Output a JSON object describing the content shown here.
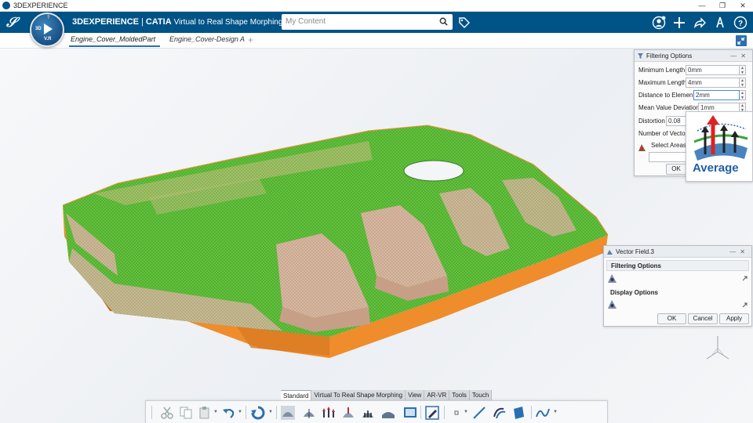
{
  "os": {
    "title": "3DEXPERIENCE",
    "controls": [
      "—",
      "❐",
      "✕"
    ]
  },
  "header": {
    "brand_bold": "3DEXPERIENCE",
    "brand_sep": "|",
    "brand_catia": "CATIA",
    "app_name": "Virtual to Real Shape Morphing",
    "compass": {
      "top": "?",
      "left": "3D",
      "bottom": "V.R"
    },
    "search_placeholder": "My Content"
  },
  "tabs": [
    {
      "label": "Engine_Cover_MoldedPart",
      "active": true
    },
    {
      "label": "Engine_Cover-Design A",
      "active": false
    }
  ],
  "tab_add": "+",
  "filtering_dialog": {
    "title": "Filtering Options",
    "controls": "—✕",
    "fields": [
      {
        "label": "Minimum Length",
        "value": "0mm"
      },
      {
        "label": "Maximum Length",
        "value": "4mm"
      },
      {
        "label": "Distance to Element",
        "value": "2mm"
      },
      {
        "label": "Mean Value Deviation",
        "value": "1mm"
      },
      {
        "label": "Distortion",
        "value": "0.08"
      },
      {
        "label": "Number of Vectors",
        "value": ""
      }
    ],
    "select_areas_label": "Select Areas T",
    "ok_label": "OK"
  },
  "tooltip": {
    "label": "Average"
  },
  "vector_dialog": {
    "title": "Vector Field.3",
    "controls": "—✕",
    "filtering_section": "Filtering Options",
    "display_section": "Display Options",
    "ok_label": "OK",
    "cancel_label": "Cancel",
    "apply_label": "Apply"
  },
  "section_tabs": [
    "Standard",
    "Virtual To Real Shape Morphing",
    "View",
    "AR-VR",
    "Tools",
    "Touch"
  ],
  "active_section_tab": "Standard",
  "colors": {
    "header": "#005386",
    "accent": "#2a6fb2",
    "mesh_green": "#5fbf3a",
    "mesh_orange": "#f08a2a",
    "mesh_tan": "#d6b49a"
  }
}
